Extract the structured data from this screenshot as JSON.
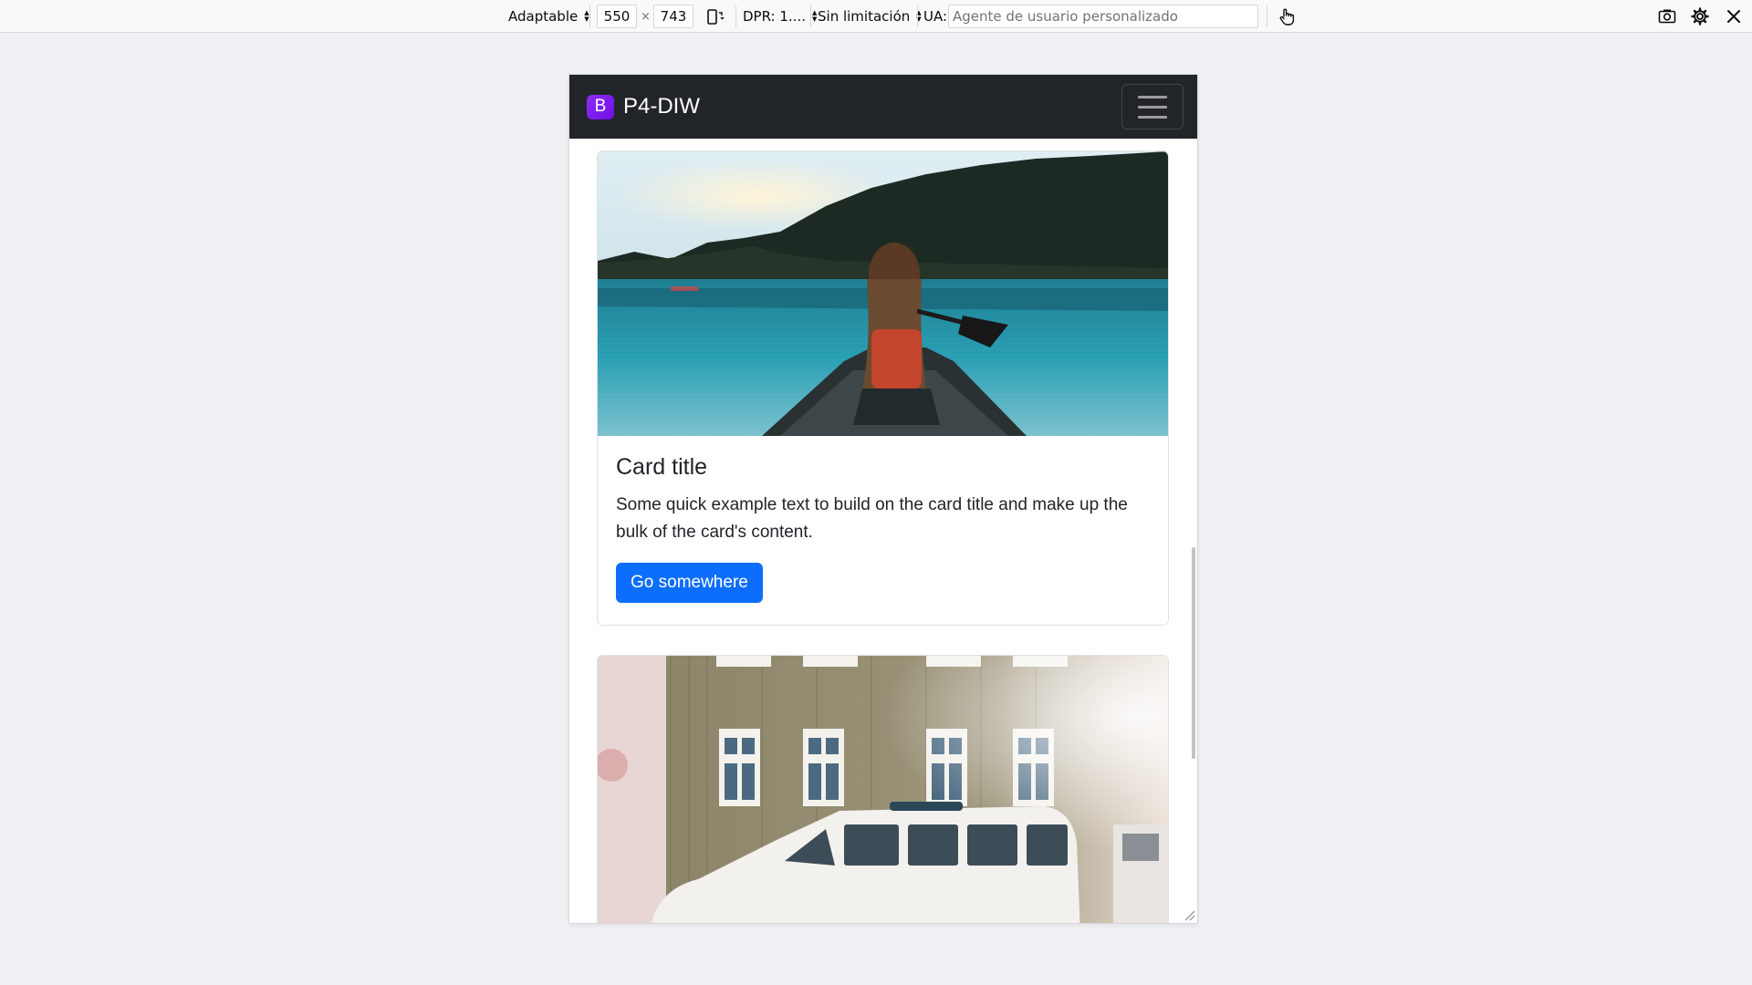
{
  "toolbar": {
    "device_select": "Adaptable",
    "width_value": "550",
    "times_sign": "×",
    "height_value": "743",
    "dpr_select": "DPR: 1....",
    "throttle_select": "Sin limitación",
    "ua_label": "UA:",
    "ua_placeholder": "Agente de usuario personalizado"
  },
  "page": {
    "brand_logo_letter": "B",
    "brand_name": "P4-DIW",
    "cards": [
      {
        "title": "Card title",
        "text": "Some quick example text to build on the card title and make up the bulk of the card's content.",
        "button": "Go somewhere",
        "image": "woman-in-canoe-on-lake"
      },
      {
        "image": "white-suv-in-front-of-house"
      }
    ]
  },
  "colors": {
    "navbar_bg": "#212529",
    "brand_logo": "#7b17ef",
    "button_primary": "#0d6efd"
  }
}
